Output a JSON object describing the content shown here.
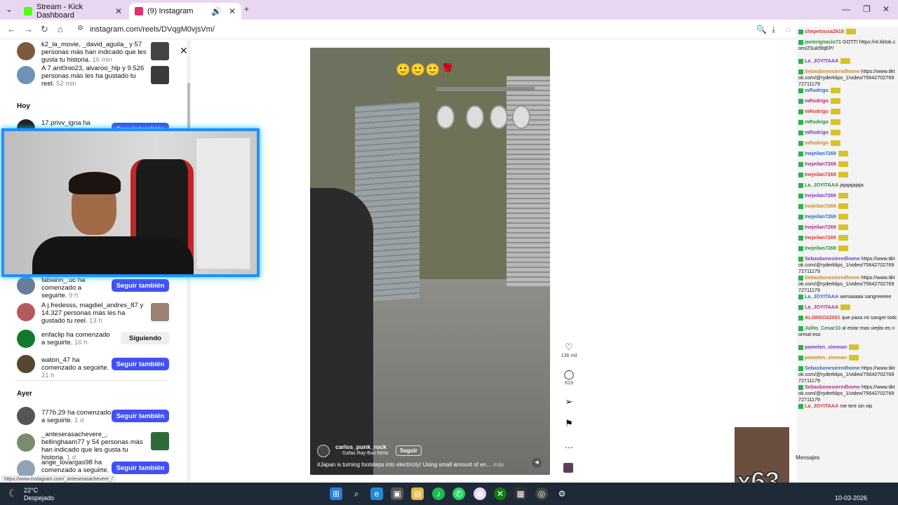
{
  "browser": {
    "tabs": [
      {
        "title": "Stream - Kick Dashboard",
        "favicon_color": "#53fc18"
      },
      {
        "title": "(9) Instagram",
        "favicon_color": "#e1306c"
      }
    ],
    "url": "instagram.com/reels/DVqgM0vjsVm/",
    "status_url": "https://www.instagram.com/_anteserasachevere_/"
  },
  "notifications": {
    "sections": {
      "today": "Hoy",
      "yesterday": "Ayer"
    },
    "items": [
      {
        "text": "k2_la_movie, _david_aguila_ y 57 personas más han indicado que les gusta tu historia.",
        "time": "16 min"
      },
      {
        "text": "A 7.ant0nio23, alvaroo_hlp y 9.526 personas más les ha gustado tu reel.",
        "time": "52 min"
      },
      {
        "text": "17.privv_igna ha comenzado a seguirte.",
        "time": "",
        "button": "Seguir también"
      },
      {
        "text": "fabiann_.uc ha comenzado a seguirte.",
        "time": "9 h",
        "button": "Seguir también"
      },
      {
        "text": "A j.fredesss, magdiel_andres_87 y 14.327 personas más les ha gustado tu reel.",
        "time": "13 h"
      },
      {
        "text": "enfaclip ha comenzado a seguirte.",
        "time": "16 h",
        "button": "Siguiendo"
      },
      {
        "text": "waton_47 ha comenzado a seguirte.",
        "time": "21 h",
        "button": "Seguir también"
      },
      {
        "text": "777b.29 ha comenzado a seguirte.",
        "time": "1 d",
        "button": "Seguir también"
      },
      {
        "text": "_anteserasachevere_, bellinghaam77 y 54 personas más han indicado que les gusta tu historia.",
        "time": "1 d"
      },
      {
        "text": "ange_lovargas98 ha comenzado a seguirte.",
        "time": "1",
        "button": "Seguir también"
      }
    ]
  },
  "reel": {
    "author": "carlos_punk_rock",
    "audio": "Gafas Ray-Ban Meta",
    "follow": "Seguir",
    "caption": "#Japan is turning footsteps into electricity! Using small amount of en…",
    "more": "más",
    "emojis": "🙂🙂🙂🌹",
    "likes": "136 mil",
    "comments": "619"
  },
  "chat": {
    "lines": [
      {
        "user": "chepetousa2619",
        "msg": ""
      },
      {
        "user": "javierignacio71",
        "msg": "GOTTI https://vt.tiktok.com/ZSuk5fqEP/"
      },
      {
        "user": "La_JOYITAAA",
        "msg": ""
      },
      {
        "user": "Sebasbonesieredhome",
        "msg": "https://www.tiktok.com/@ryderklips_1/video/7564270276972711179"
      },
      {
        "user": "mRodrigo",
        "msg": ""
      },
      {
        "user": "mRodrigo",
        "msg": ""
      },
      {
        "user": "mRodrigo",
        "msg": ""
      },
      {
        "user": "mRodrigo",
        "msg": ""
      },
      {
        "user": "mRodrigo",
        "msg": ""
      },
      {
        "user": "mRodrigo",
        "msg": ""
      },
      {
        "user": "Inejeilan7269",
        "msg": ""
      },
      {
        "user": "Inejeilan7269",
        "msg": ""
      },
      {
        "user": "Inejeilan7269",
        "msg": ""
      },
      {
        "user": "La_JOYITAAA",
        "msg": "jajajajajaja"
      },
      {
        "user": "Inejeilan7269",
        "msg": ""
      },
      {
        "user": "Inejeilan7269",
        "msg": ""
      },
      {
        "user": "Inejeilan7269",
        "msg": ""
      },
      {
        "user": "Inejeilan7269",
        "msg": ""
      },
      {
        "user": "Inejeilan7269",
        "msg": ""
      },
      {
        "user": "Inejeilan7269",
        "msg": ""
      },
      {
        "user": "Sebasbonesieredhome",
        "msg": "https://www.tiktok.com/@ryderklips_1/video/7564270276972711179"
      },
      {
        "user": "Sebasbonesieredhome",
        "msg": "https://www.tiktok.com/@ryderklips_1/video/7564270276972711179"
      },
      {
        "user": "La_JOYITAAA",
        "msg": "wenaaaaa sangreeeee"
      },
      {
        "user": "La_JOYITAAA",
        "msg": ""
      },
      {
        "user": "ALONSO22001",
        "msg": "que pasa mi sangre todo bien"
      },
      {
        "user": "Julito_Cesar10",
        "msg": "al estar mas viejito es normal eso"
      },
      {
        "user": "pamelen_simman",
        "msg": ""
      },
      {
        "user": "pamelen_simman",
        "msg": ""
      },
      {
        "user": "Sebasbonesieredhome",
        "msg": "https://www.tiktok.com/@ryderklips_1/video/7564270276972711179"
      },
      {
        "user": "Sebasbonesieredhome",
        "msg": "https://www.tiktok.com/@ryderklips_1/video/7564270276972711179"
      },
      {
        "user": "La_JOYITAAA",
        "msg": "me teni sin vip"
      }
    ],
    "mensajes_label": "Mensajes",
    "multiplier": "x63"
  },
  "taskbar": {
    "temp": "22°C",
    "weather": "Despejado",
    "date": "10-03-2026",
    "time": ""
  }
}
